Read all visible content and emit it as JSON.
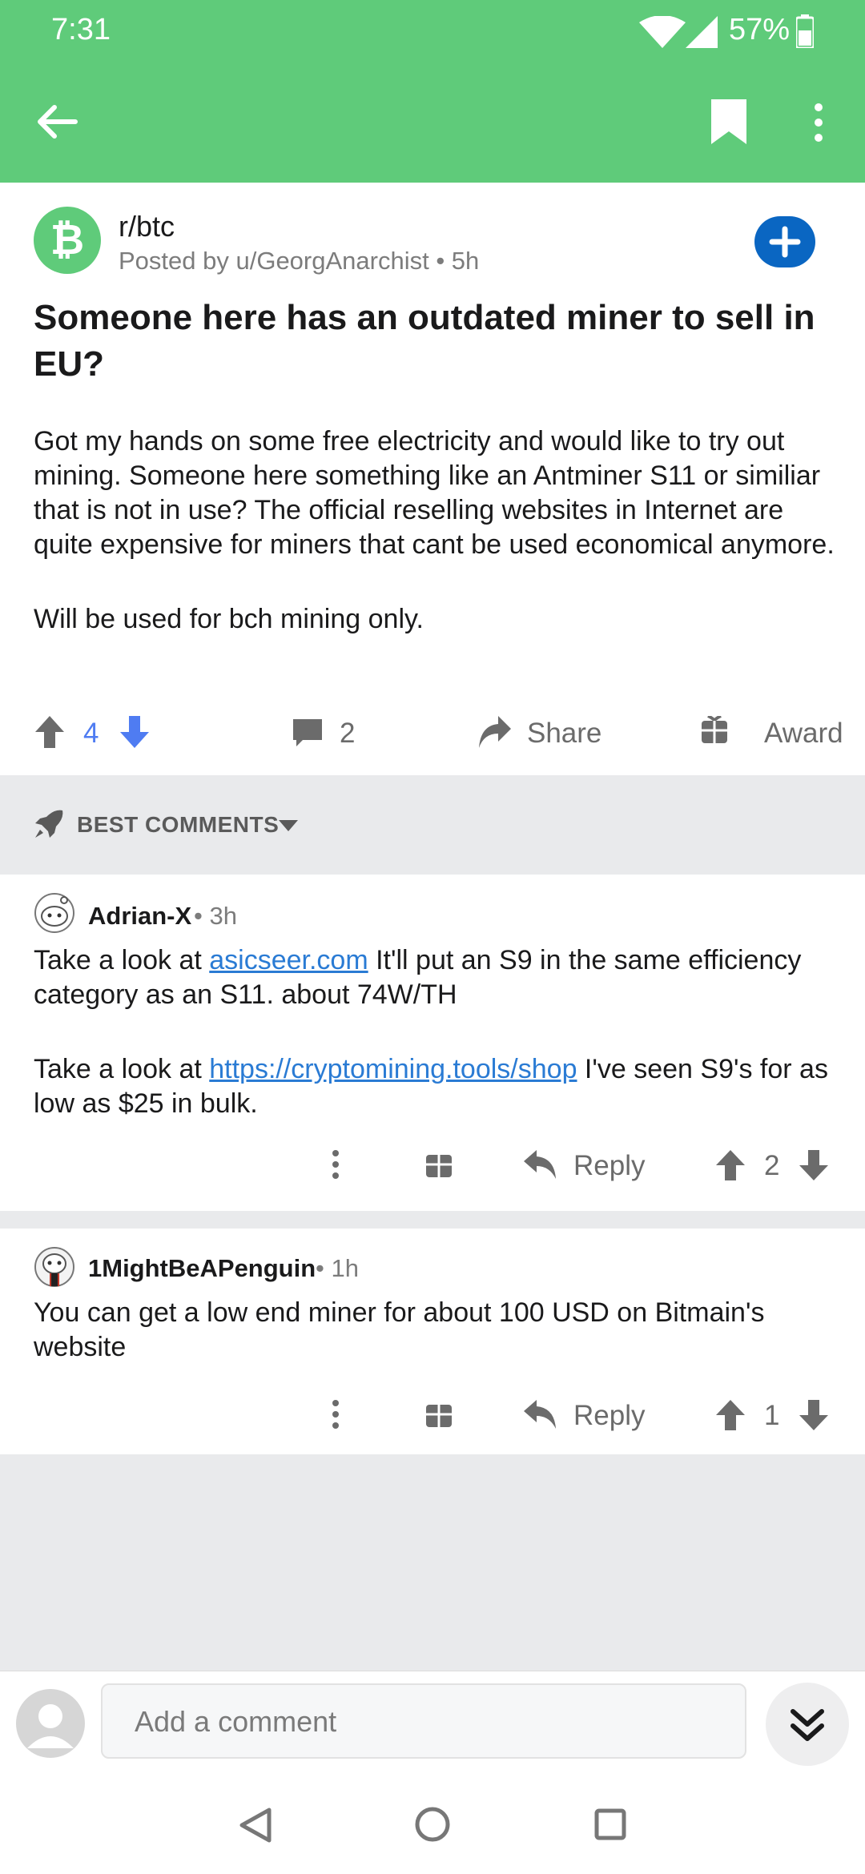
{
  "status": {
    "time": "7:31",
    "battery": "57%"
  },
  "post": {
    "subreddit": "r/btc",
    "posted_by": "Posted by u/GeorgAnarchist • 5h",
    "title": "Someone here has an outdated miner to sell in EU?",
    "body_p1": "Got my hands on some free electricity and would like to try out mining. Someone here something like an Antminer S11 or similiar that is not in use? The official reselling websites in Internet are quite expensive for miners that cant be used economical anymore.",
    "body_p2": "Will be used for bch mining only.",
    "votes": "4",
    "comments": "2",
    "share_label": "Share",
    "award_label": "Award"
  },
  "sort": {
    "label": "BEST COMMENTS"
  },
  "comments": [
    {
      "author": "Adrian-X",
      "time": "• 3h",
      "p1_a": "Take a look at ",
      "p1_link": "asicseer.com",
      "p1_b": " It'll put an S9 in the same efficiency category as an S11. about 74W/TH",
      "p2_a": "Take a look at ",
      "p2_link": "https://cryptomining.tools/shop",
      "p2_b": " I've seen S9's for as low as $25 in bulk.",
      "reply_label": "Reply",
      "votes": "2"
    },
    {
      "author": "1MightBeAPenguin",
      "time": "• 1h",
      "text": "You can get a low end miner for about 100 USD on Bitmain's website",
      "reply_label": "Reply",
      "votes": "1"
    }
  ],
  "composer": {
    "placeholder": "Add a comment"
  },
  "colors": {
    "header": "#5FCB7A",
    "join": "#0a66c2",
    "upvoted": "#4f7cf2",
    "link": "#2a7bd4"
  }
}
